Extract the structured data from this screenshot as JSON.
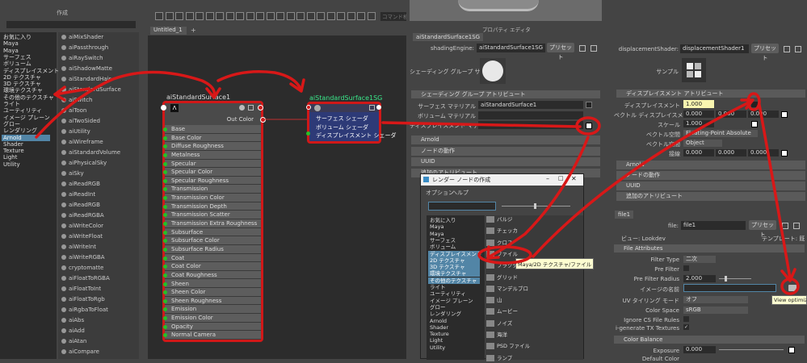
{
  "create_panel": {
    "title": "作成",
    "tree": [
      {
        "label": "お気に入り",
        "sel": false
      },
      {
        "label": "Maya",
        "sel": false
      },
      {
        "label": "Maya",
        "sel": false
      },
      {
        "label": "サーフェス",
        "sel": false
      },
      {
        "label": "ボリューム",
        "sel": false
      },
      {
        "label": "ディスプレイスメント",
        "sel": false
      },
      {
        "label": "2D テクスチャ",
        "sel": false
      },
      {
        "label": "3D テクスチャ",
        "sel": false
      },
      {
        "label": "環境テクスチャ",
        "sel": false
      },
      {
        "label": "その他のテクスチャ",
        "sel": false
      },
      {
        "label": "ライト",
        "sel": false
      },
      {
        "label": "ユーティリティ",
        "sel": false
      },
      {
        "label": "イメージ プレーン",
        "sel": false
      },
      {
        "label": "グロー",
        "sel": false
      },
      {
        "label": "レンダリング",
        "sel": false
      },
      {
        "label": "Arnold",
        "sel": true
      },
      {
        "label": "Shader",
        "sel": false
      },
      {
        "label": "Texture",
        "sel": false
      },
      {
        "label": "Light",
        "sel": false
      },
      {
        "label": "Utility",
        "sel": false
      }
    ],
    "library": [
      "aiMixShader",
      "aiPassthrough",
      "aiRaySwitch",
      "aiShadowMatte",
      "aiStandardHair",
      "aiStandardSurface",
      "aiSwitch",
      "aiToon",
      "aiTwoSided",
      "aiUtility",
      "aiWireframe",
      "aiStandardVolume",
      "aiPhysicalSky",
      "aiSky",
      "aiReadRGB",
      "aiReadInt",
      "aiReadRGB",
      "aiReadRGBA",
      "aiWriteColor",
      "aiWriteFloat",
      "aiWriteInt",
      "aiWriteRGBA",
      "cryptomatte",
      "aiFloatToRGBA",
      "aiFloatToInt",
      "aiFloatToRgb",
      "aiRgbaToFloat",
      "aiAbs",
      "aiAdd",
      "aiAtan",
      "aiCompare"
    ]
  },
  "graph": {
    "tab": "Untitled_1",
    "tab_add": "+",
    "search_placeholder": "コマンド検",
    "node1": {
      "title": "aiStandardSurface1",
      "out": "Out Color",
      "attrs": [
        "Base",
        "Base Color",
        "Diffuse Roughness",
        "Metalness",
        "Specular",
        "Specular Color",
        "Specular Roughness",
        "Transmission",
        "Transmission Color",
        "Transmission Depth",
        "Transmission Scatter",
        "Transmission Extra Roughness",
        "Subsurface",
        "Subsurface Color",
        "Subsurface Radius",
        "Coat",
        "Coat Color",
        "Coat Roughness",
        "Sheen",
        "Sheen Color",
        "Sheen Roughness",
        "Emission",
        "Emission Color",
        "Opacity",
        "Normal Camera"
      ]
    },
    "node2": {
      "title": "aiStandardSurface1SG",
      "attrs": [
        "サーフェス シェーダ",
        "ボリューム シェーダ",
        "ディスプレイスメント シェーダ"
      ]
    }
  },
  "attr_editor": {
    "header": "プロパティ エディタ",
    "tab": "aiStandardSurface1SG",
    "engine_label": "shadingEngine:",
    "engine_value": "aiStandardSurface1SG",
    "preset": "プリセット",
    "sample_label": "シェーディング グループ サンプル",
    "section1": "シェーディング グループ アトリビュート",
    "surface_label": "サーフェス マテリアル",
    "surface_value": "aiStandardSurface1",
    "volume_label": "ボリューム マテリアル",
    "disp_label": "ディスプレイスメント マテリアル",
    "sections": [
      "Arnold",
      "ノードの動作",
      "UUID",
      "追加のアトリビュート"
    ]
  },
  "render_node": {
    "title": "レンダー ノードの作成",
    "menus": [
      "オプション",
      "ヘルプ"
    ],
    "left": [
      "お気に入り",
      "Maya",
      "Maya",
      "サーフェス",
      "ボリューム",
      "ディスプレイスメント",
      "2D テクスチャ",
      "3D テクスチャ",
      "環境テクスチャ",
      "その他のテクスチャ",
      "ライト",
      "ユーティリティ",
      "イメージ プレーン",
      "グロー",
      "レンダリング",
      "Arnold",
      "Shader",
      "Texture",
      "Light",
      "Utility"
    ],
    "right": [
      "バルジ",
      "チェッカ",
      "クロス",
      "ファイル",
      "フラクタル",
      "グリッド",
      "マンデルブロ",
      "山",
      "ムービー",
      "ノイズ",
      "海洋",
      "PSD ファイル",
      "ランプ"
    ],
    "tooltip": "Maya/2D テクスチャ/ファイル"
  },
  "disp_panel": {
    "label": "displacementShader:",
    "value": "displacementShader1",
    "preset": "プリセット",
    "sample_label": "サンプル",
    "section": "ディスプレイスメント アトリビュート",
    "disp_label": "ディスプレイスメント",
    "disp_value": "1.000",
    "vec_label": "ベクトル ディスプレイスメント",
    "vec_values": [
      "0.000",
      "0.000",
      "0.000"
    ],
    "scale_label": "スケール",
    "scale_value": "1.000",
    "space_label": "ベクトル空間",
    "space_value": "Floating-Point Absolute",
    "vspace_label": "ベクトル空間",
    "vspace_value": "Object",
    "tangent_label": "接線",
    "tangent_values": [
      "0.000",
      "0.000",
      "0.000"
    ],
    "sections": [
      "Arnold",
      "ノードの動作",
      "UUID",
      "追加のアトリビュート"
    ]
  },
  "file_panel": {
    "tab": "file1",
    "file_label": "file:",
    "file_value": "file1",
    "preset": "プリセット",
    "view": "ビュー: Lookdev",
    "template": "テンプレート: 既",
    "section1": "File Attributes",
    "filter_type_label": "Filter Type",
    "filter_type_value": "二次",
    "pre_filter_label": "Pre Filter",
    "pre_filter_radius_label": "Pre Filter Radius",
    "pre_filter_radius_value": "2.000",
    "image_name_label": "イメージの名前",
    "uv_tiling_label": "UV タイリング モード",
    "uv_tiling_value": "オフ",
    "color_space_label": "Color Space",
    "color_space_value": "sRGB",
    "ignore_label": "Ignore CS File Rules",
    "tx_label": "i-generate TX Textures",
    "section2": "Color Balance",
    "exposure_label": "Exposure",
    "exposure_value": "0.000",
    "default_color_label": "Default Color",
    "tooltip": "View optimize"
  }
}
